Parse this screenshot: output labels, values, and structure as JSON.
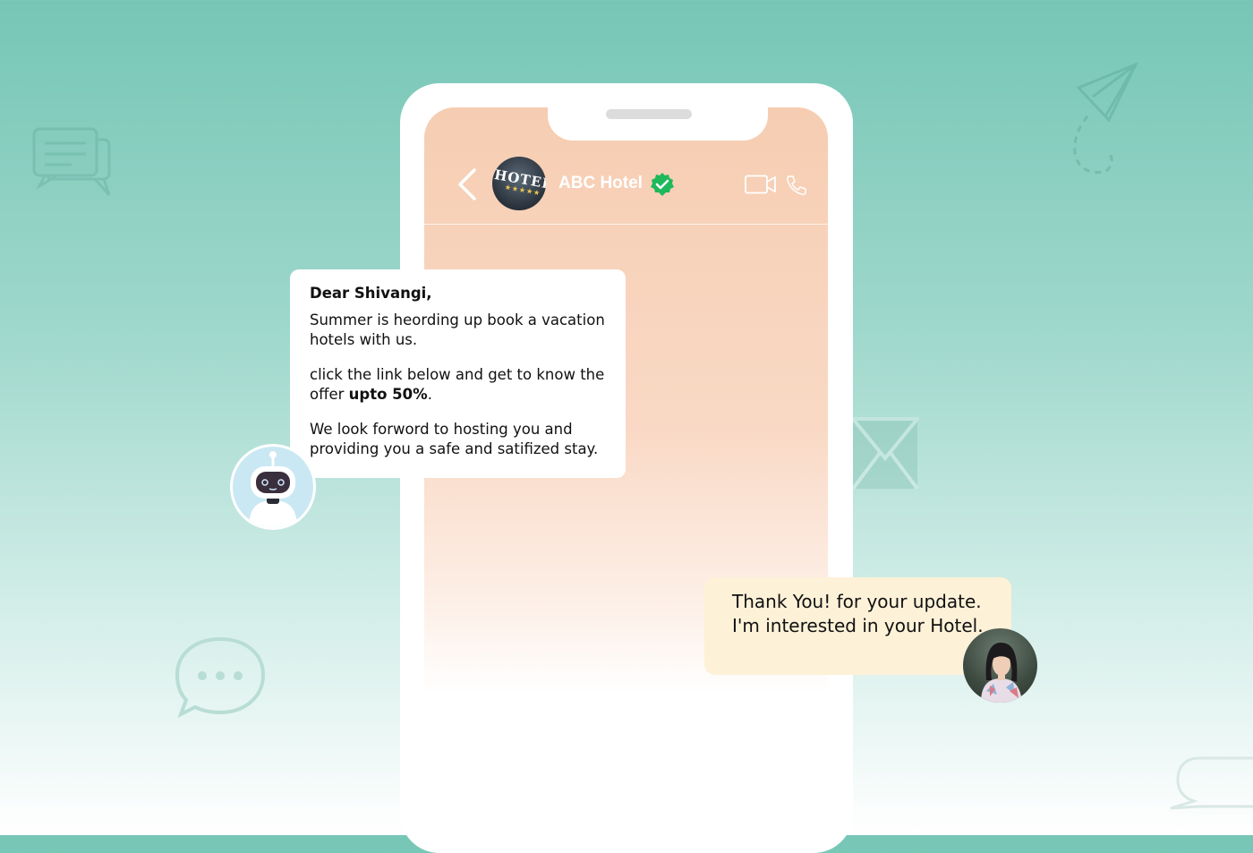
{
  "header": {
    "contact_name": "ABC Hotel",
    "avatar_sign": "HOTEL",
    "avatar_stars": "★★★★★",
    "icons": [
      "chevron-left-icon",
      "verified-check-icon",
      "video-camera-icon",
      "phone-icon"
    ]
  },
  "bot_message": {
    "greeting": "Dear Shivangi,",
    "line1": "Summer is heording up book a vacation hotels with us.",
    "line2_prefix": "click the link below and get to know the offer ",
    "line2_bold": "upto 50%",
    "line2_suffix": ".",
    "line3": "We look forword to hosting you and providing you a safe and satifized stay."
  },
  "user_message": {
    "text": "Thank You!  for your update. I'm interested in your Hotel."
  },
  "colors": {
    "verified": "#1fb85a",
    "user_bubble": "#fdf1d8",
    "bot_bubble": "#ffffff",
    "background_top": "#76c6b6"
  }
}
